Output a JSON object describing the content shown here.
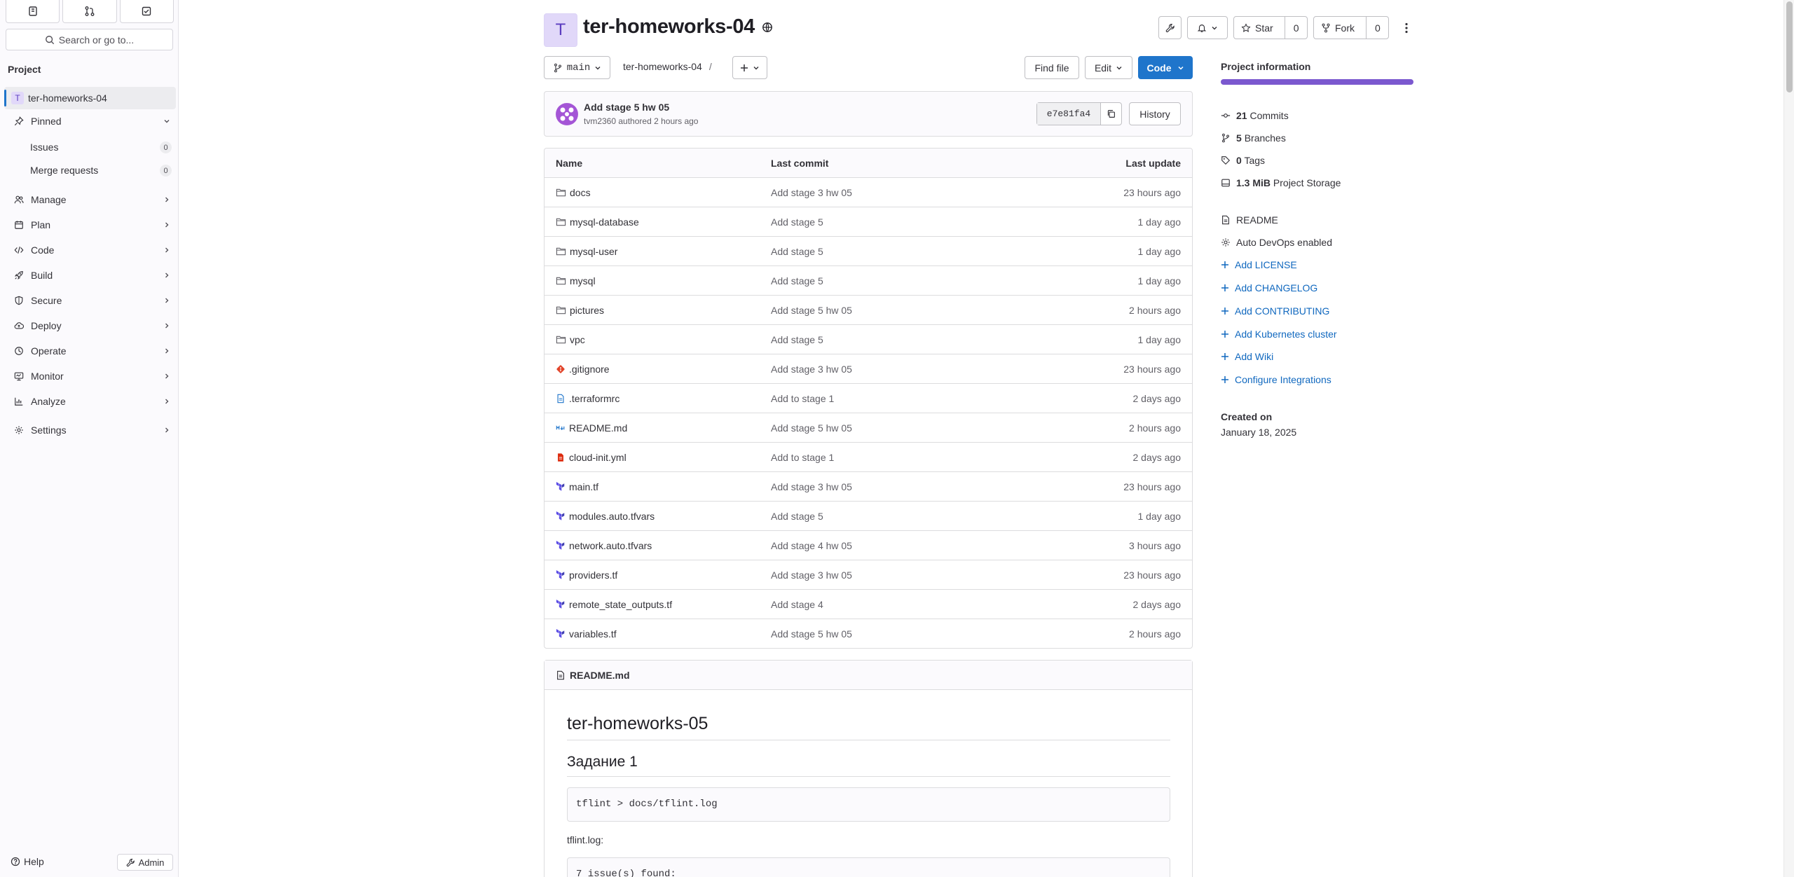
{
  "sidebar": {
    "search_placeholder": "Search or go to...",
    "section_label": "Project",
    "project_avatar_letter": "T",
    "project_name": "ter-homeworks-04",
    "pinned_label": "Pinned",
    "pinned": [
      {
        "label": "Issues",
        "count": "0"
      },
      {
        "label": "Merge requests",
        "count": "0"
      }
    ],
    "nav": [
      {
        "label": "Manage",
        "icon": "users-icon"
      },
      {
        "label": "Plan",
        "icon": "calendar-icon"
      },
      {
        "label": "Code",
        "icon": "code-icon"
      },
      {
        "label": "Build",
        "icon": "rocket-icon"
      },
      {
        "label": "Secure",
        "icon": "shield-icon"
      },
      {
        "label": "Deploy",
        "icon": "cloud-icon"
      },
      {
        "label": "Operate",
        "icon": "operate-icon"
      },
      {
        "label": "Monitor",
        "icon": "monitor-icon"
      },
      {
        "label": "Analyze",
        "icon": "chart-icon"
      },
      {
        "label": "Settings",
        "icon": "gear-icon"
      }
    ],
    "help_label": "Help",
    "admin_label": "Admin"
  },
  "header": {
    "avatar_letter": "T",
    "title": "ter-homeworks-04",
    "star_label": "Star",
    "star_count": "0",
    "fork_label": "Fork",
    "fork_count": "0"
  },
  "toolbar": {
    "branch": "main",
    "breadcrumb": "ter-homeworks-04",
    "breadcrumb_sep": "/",
    "find_file": "Find file",
    "edit": "Edit",
    "code": "Code"
  },
  "last_commit": {
    "title": "Add stage 5 hw 05",
    "author": "tvm2360",
    "meta": "authored 2 hours ago",
    "sha": "e7e81fa4",
    "history": "History"
  },
  "file_table": {
    "headers": {
      "name": "Name",
      "commit": "Last commit",
      "update": "Last update"
    },
    "rows": [
      {
        "name": "docs",
        "type": "folder",
        "commit": "Add stage 3 hw 05",
        "update": "23 hours ago"
      },
      {
        "name": "mysql-database",
        "type": "folder",
        "commit": "Add stage 5",
        "update": "1 day ago"
      },
      {
        "name": "mysql-user",
        "type": "folder",
        "commit": "Add stage 5",
        "update": "1 day ago"
      },
      {
        "name": "mysql",
        "type": "folder",
        "commit": "Add stage 5",
        "update": "1 day ago"
      },
      {
        "name": "pictures",
        "type": "folder",
        "commit": "Add stage 5 hw 05",
        "update": "2 hours ago"
      },
      {
        "name": "vpc",
        "type": "folder",
        "commit": "Add stage 5",
        "update": "1 day ago"
      },
      {
        "name": ".gitignore",
        "type": "git",
        "commit": "Add stage 3 hw 05",
        "update": "23 hours ago"
      },
      {
        "name": ".terraformrc",
        "type": "file",
        "commit": "Add to stage 1",
        "update": "2 days ago"
      },
      {
        "name": "README.md",
        "type": "markdown",
        "commit": "Add stage 5 hw 05",
        "update": "2 hours ago"
      },
      {
        "name": "cloud-init.yml",
        "type": "yaml",
        "commit": "Add to stage 1",
        "update": "2 days ago"
      },
      {
        "name": "main.tf",
        "type": "terraform",
        "commit": "Add stage 3 hw 05",
        "update": "23 hours ago"
      },
      {
        "name": "modules.auto.tfvars",
        "type": "terraform",
        "commit": "Add stage 5",
        "update": "1 day ago"
      },
      {
        "name": "network.auto.tfvars",
        "type": "terraform",
        "commit": "Add stage 4 hw 05",
        "update": "3 hours ago"
      },
      {
        "name": "providers.tf",
        "type": "terraform",
        "commit": "Add stage 3 hw 05",
        "update": "23 hours ago"
      },
      {
        "name": "remote_state_outputs.tf",
        "type": "terraform",
        "commit": "Add stage 4",
        "update": "2 days ago"
      },
      {
        "name": "variables.tf",
        "type": "terraform",
        "commit": "Add stage 5 hw 05",
        "update": "2 hours ago"
      }
    ]
  },
  "readme": {
    "filename": "README.md",
    "h1": "ter-homeworks-05",
    "h2": "Задание 1",
    "code1": "tflint > docs/tflint.log",
    "p1": "tflint.log:",
    "code2": "7 issue(s) found:"
  },
  "project_info": {
    "title": "Project information",
    "bar_fill_fraction": 1.0,
    "stats": [
      {
        "value": "21",
        "label": "Commits",
        "icon": "commit-icon"
      },
      {
        "value": "5",
        "label": "Branches",
        "icon": "branch-icon"
      },
      {
        "value": "0",
        "label": "Tags",
        "icon": "tag-icon"
      },
      {
        "value": "1.3 MiB",
        "label": "Project Storage",
        "icon": "storage-icon"
      }
    ],
    "readme": "README",
    "autodevops": "Auto DevOps enabled",
    "links": [
      "Add LICENSE",
      "Add CHANGELOG",
      "Add CONTRIBUTING",
      "Add Kubernetes cluster",
      "Add Wiki",
      "Configure Integrations"
    ],
    "created_label": "Created on",
    "created_value": "January 18, 2025"
  },
  "colors": {
    "accent": "#1f75cb",
    "link": "#1068bf",
    "progress": "#7b58cf",
    "avatar_bg": "#e1d8f9"
  }
}
